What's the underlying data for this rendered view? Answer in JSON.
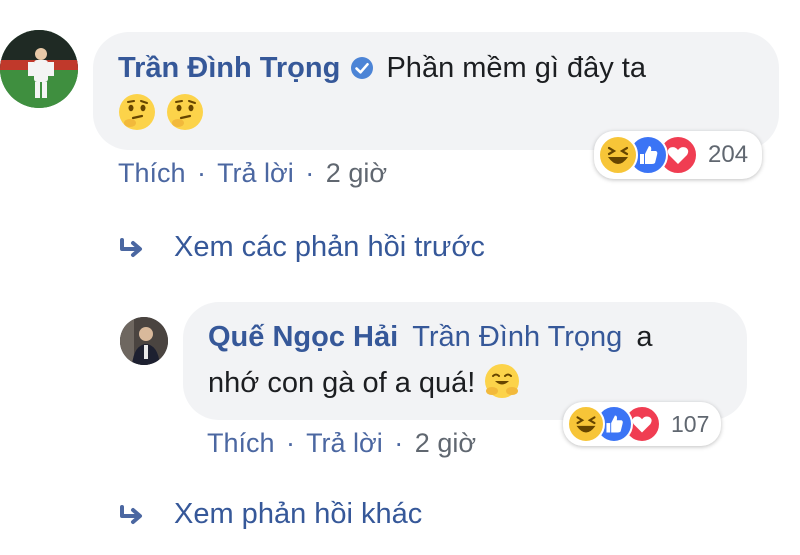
{
  "comment": {
    "author": "Trần Đình Trọng",
    "text": "Phần mềm gì đây ta",
    "emoji_name": "thinking-face-emoji",
    "reaction_count": "204",
    "actions": {
      "like": "Thích",
      "reply": "Trả lời",
      "separator": "·",
      "time": "2 giờ"
    }
  },
  "view_previous_replies": "Xem các phản hồi trước",
  "reply": {
    "author": "Quế Ngọc Hải",
    "mention": "Trần Đình Trọng",
    "text_line1": "a",
    "text_line2": "nhớ con gà of a quá!",
    "emoji_name": "hugging-face-emoji",
    "reaction_count": "107",
    "actions": {
      "like": "Thích",
      "reply": "Trả lời",
      "separator": "·",
      "time": "2 giờ"
    }
  },
  "view_more_replies": "Xem phản hồi khác",
  "colors": {
    "name_blue": "#365899",
    "bubble_bg": "#f2f3f5",
    "verified_blue": "#4c84d6",
    "haha_yellow": "#f7c538",
    "like_blue": "#3b74f5",
    "love_red": "#f03d52"
  }
}
